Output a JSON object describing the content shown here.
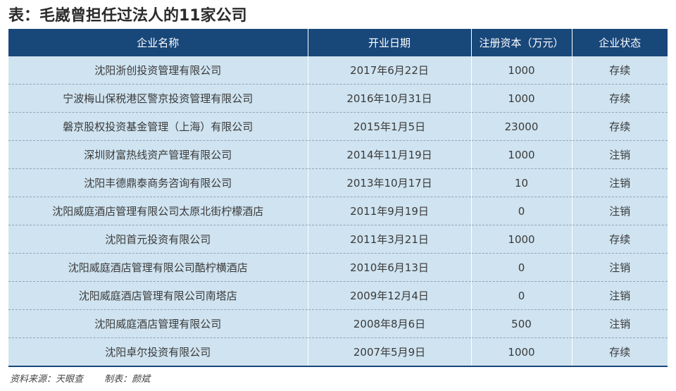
{
  "title": "表：毛崴曾担任过法人的11家公司",
  "table": {
    "headers": [
      "企业名称",
      "开业日期",
      "注册资本（万元）",
      "企业状态"
    ],
    "rows": [
      [
        "沈阳浙创投资管理有限公司",
        "2017年6月22日",
        "1000",
        "存续"
      ],
      [
        "宁波梅山保税港区警京投资管理有限公司",
        "2016年10月31日",
        "1000",
        "存续"
      ],
      [
        "磐京股权投资基金管理（上海）有限公司",
        "2015年1月5日",
        "23000",
        "存续"
      ],
      [
        "深圳财富热线资产管理有限公司",
        "2014年11月19日",
        "1000",
        "注销"
      ],
      [
        "沈阳丰德鼎泰商务咨询有限公司",
        "2013年10月17日",
        "10",
        "注销"
      ],
      [
        "沈阳威庭酒店管理有限公司太原北街柠檬酒店",
        "2011年9月19日",
        "0",
        "注销"
      ],
      [
        "沈阳首元投资有限公司",
        "2011年3月21日",
        "1000",
        "存续"
      ],
      [
        "沈阳威庭酒店管理有限公司酷柠横酒店",
        "2010年6月13日",
        "0",
        "注销"
      ],
      [
        "沈阳威庭酒店管理有限公司南塔店",
        "2009年12月4日",
        "0",
        "注销"
      ],
      [
        "沈阳威庭酒店管理有限公司",
        "2008年8月6日",
        "500",
        "注销"
      ],
      [
        "沈阳卓尔投资有限公司",
        "2007年5月9日",
        "1000",
        "存续"
      ]
    ]
  },
  "footer": {
    "source": "资料来源：天眼查",
    "author": "制表：颜斌"
  },
  "colors": {
    "header_bg": "#18477a",
    "row_bg": "#cfe3f0"
  }
}
